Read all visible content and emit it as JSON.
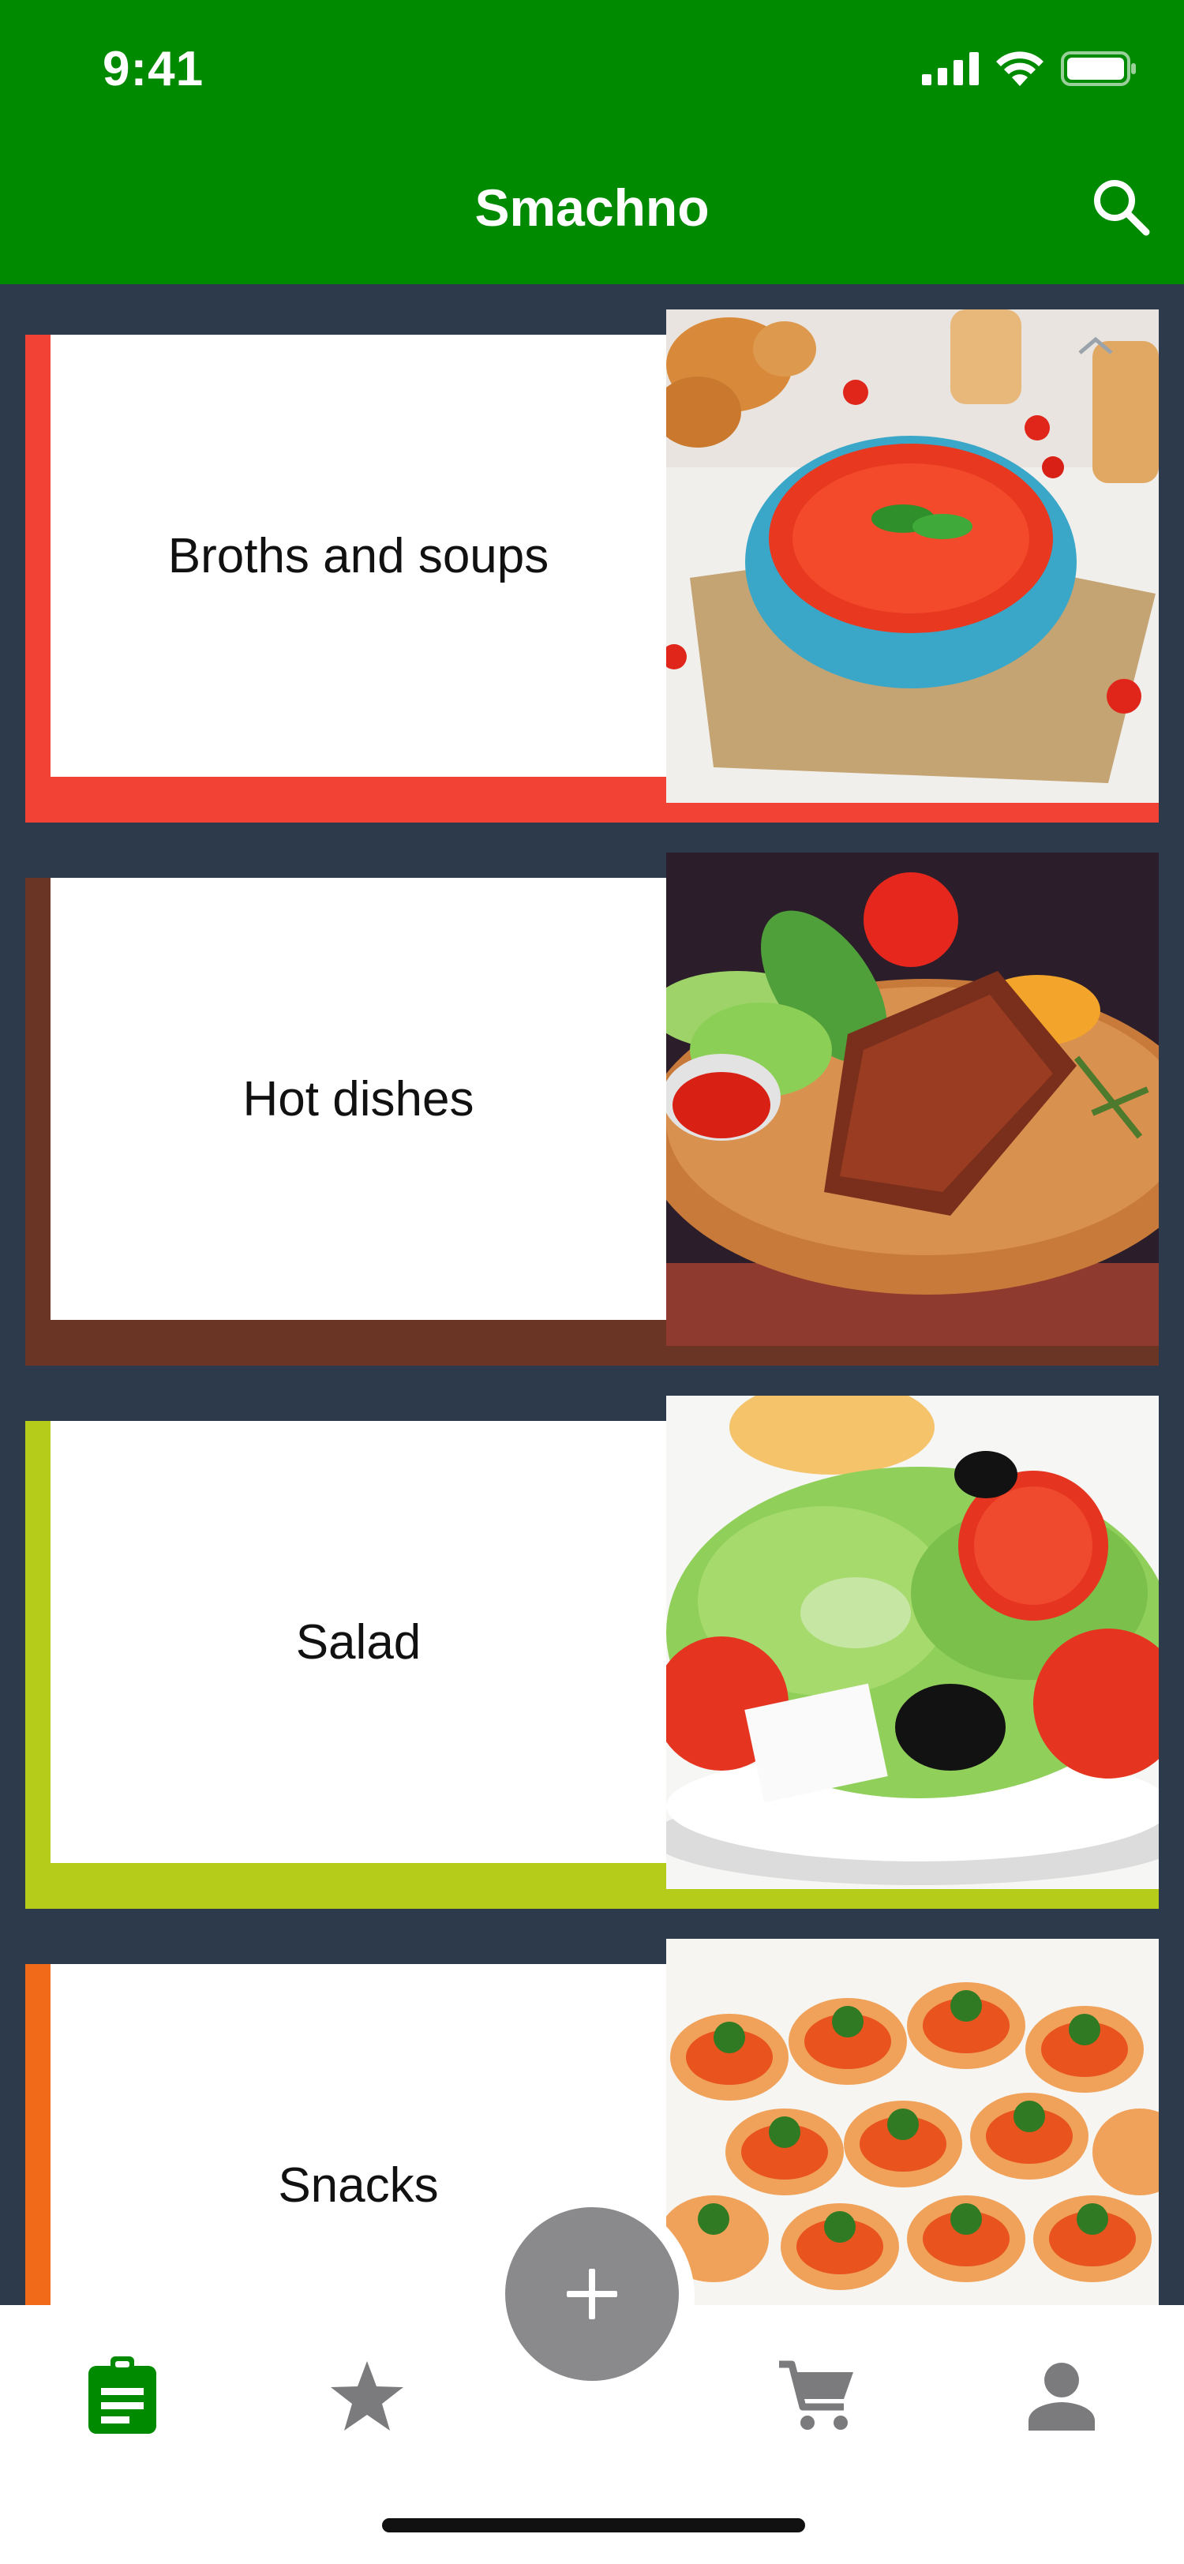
{
  "status_bar": {
    "time": "9:41"
  },
  "header": {
    "title": "Smachno",
    "search_icon": "search-icon"
  },
  "categories": [
    {
      "label": "Broths and soups",
      "accent_color": "#f24236",
      "image": "tomato-soup-photo"
    },
    {
      "label": "Hot dishes",
      "accent_color": "#6b3526",
      "image": "grilled-steak-photo"
    },
    {
      "label": "Salad",
      "accent_color": "#b6cc1b",
      "image": "greek-salad-photo"
    },
    {
      "label": "Snacks",
      "accent_color": "#f06a1a",
      "image": "caviar-canapes-photo"
    }
  ],
  "tab_bar": {
    "active_color": "#008a00",
    "inactive_color": "#8a8a8d",
    "tabs": [
      {
        "icon": "clipboard-icon",
        "active": true
      },
      {
        "icon": "star-icon",
        "active": false
      },
      {
        "icon": "add-icon",
        "active": false
      },
      {
        "icon": "cart-icon",
        "active": false
      },
      {
        "icon": "profile-icon",
        "active": false
      }
    ]
  }
}
